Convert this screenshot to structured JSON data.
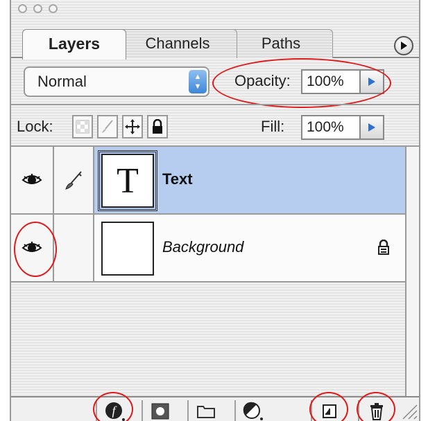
{
  "window": {
    "buttons": [
      "close-button",
      "minimize-button",
      "zoom-button"
    ]
  },
  "tabs": [
    {
      "label": "Layers",
      "active": true
    },
    {
      "label": "Channels",
      "active": false
    },
    {
      "label": "Paths",
      "active": false
    }
  ],
  "blend": {
    "mode": "Normal"
  },
  "opacity": {
    "label": "Opacity:",
    "value": "100%"
  },
  "lock": {
    "label": "Lock:",
    "icons": [
      "lock-transparent-pixels-icon",
      "lock-image-pixels-icon",
      "lock-position-icon",
      "lock-all-icon"
    ]
  },
  "fill": {
    "label": "Fill:",
    "value": "100%"
  },
  "layers": [
    {
      "name": "Text",
      "thumbnail": "T",
      "selected": true,
      "visible": true,
      "linked_brush": true,
      "locked": false
    },
    {
      "name": "Background",
      "thumbnail": "",
      "selected": false,
      "visible": true,
      "linked_brush": false,
      "locked": true,
      "italic": true
    }
  ],
  "toolbar": {
    "buttons": [
      "add-layer-style-icon",
      "add-layer-mask-icon",
      "new-layer-set-icon",
      "new-fill-adjustment-layer-icon",
      "new-layer-icon",
      "delete-layer-icon"
    ]
  },
  "colors": {
    "selection": "#b6cdf0",
    "highlight_annotation": "#e01818",
    "accent_blue": "#3e86d8"
  }
}
